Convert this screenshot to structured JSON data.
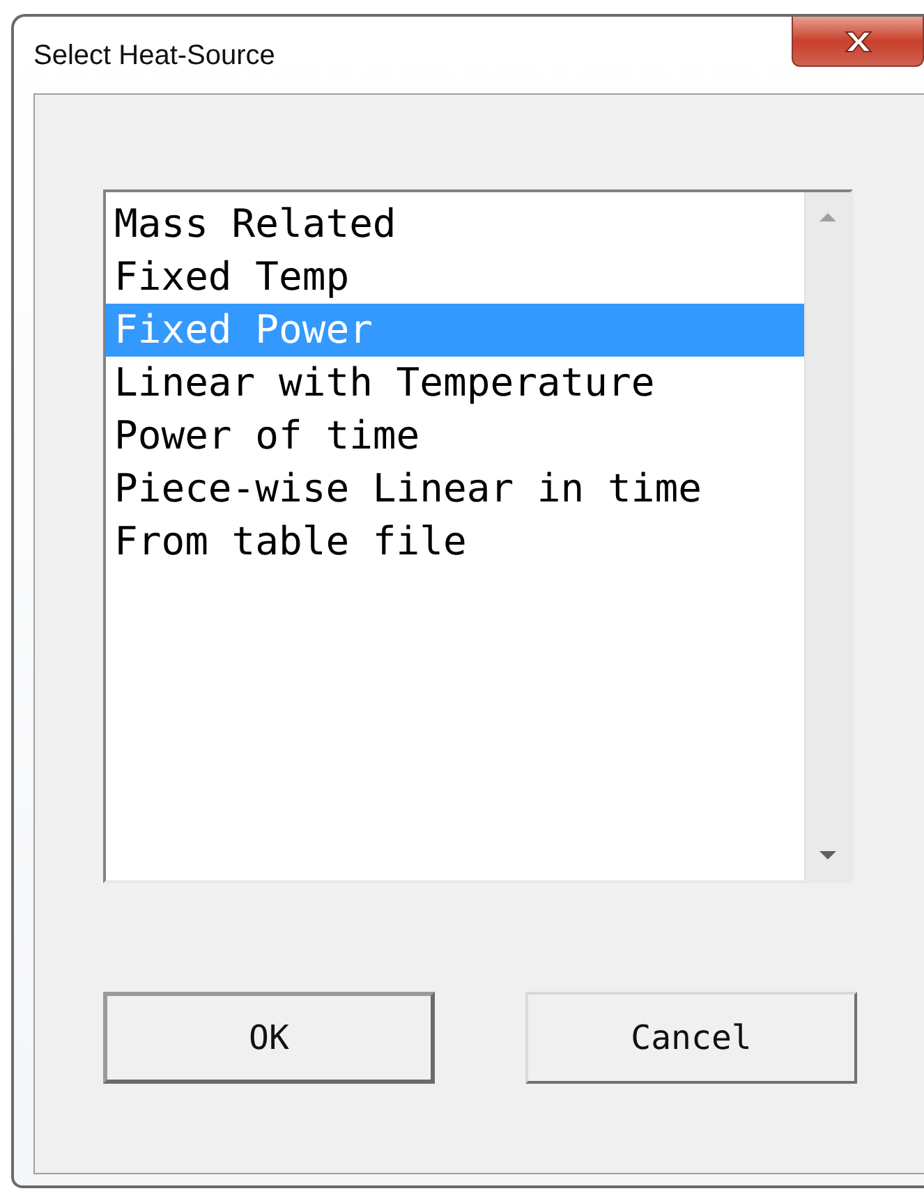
{
  "window": {
    "title": "Select Heat-Source"
  },
  "list": {
    "items": [
      {
        "label": "Mass Related",
        "selected": false
      },
      {
        "label": "Fixed Temp",
        "selected": false
      },
      {
        "label": "Fixed Power",
        "selected": true
      },
      {
        "label": "Linear with Temperature",
        "selected": false
      },
      {
        "label": "Power of time",
        "selected": false
      },
      {
        "label": "Piece-wise Linear in time",
        "selected": false
      },
      {
        "label": "From table file",
        "selected": false
      }
    ]
  },
  "buttons": [
    {
      "label": "OK",
      "kind": "default"
    },
    {
      "label": "Cancel",
      "kind": "normal"
    }
  ]
}
